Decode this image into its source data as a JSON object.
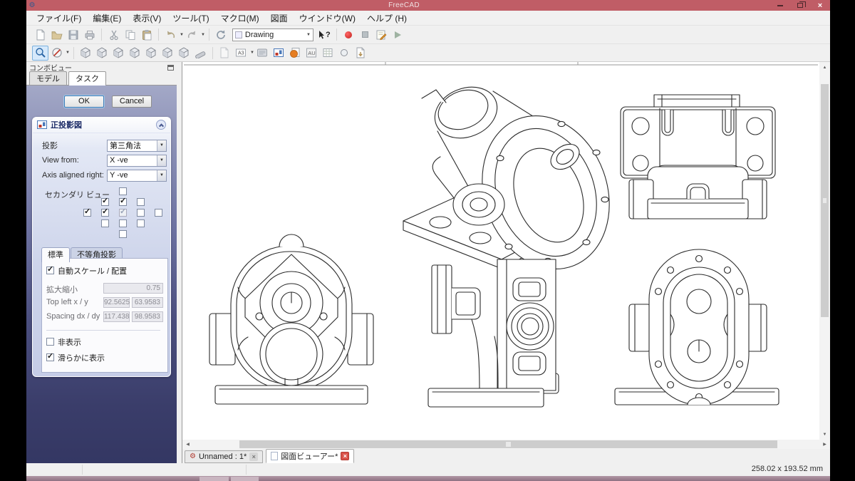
{
  "glyphs": {
    "close": "×",
    "gear": "⚙",
    "dropdown": "▼",
    "check": "✓",
    "scroll_up": "▲",
    "scroll_down": "▼",
    "scroll_left": "◀",
    "scroll_right": "▶",
    "whats_this": "?"
  },
  "window": {
    "title": "FreeCAD"
  },
  "menubar": {
    "items": [
      "ファイル(F)",
      "編集(E)",
      "表示(V)",
      "ツール(T)",
      "マクロ(M)",
      "図面",
      "ウインドウ(W)",
      "ヘルプ (H)"
    ]
  },
  "toolbars": {
    "workbench_value": "Drawing",
    "paper_size": "A3",
    "symbol_label": "AU"
  },
  "combo_view": {
    "title": "コンボビュー",
    "model_tab": "モデル",
    "task_tab": "タスク",
    "task": {
      "ok": "OK",
      "cancel": "Cancel",
      "section_title": "正投影図",
      "projection_label": "投影",
      "projection_value": "第三角法",
      "view_from_label": "View from:",
      "view_from_value": "X -ve",
      "axis_label": "Axis aligned right:",
      "axis_value": "Y -ve",
      "secondary_label": "セカンダリ ビュー",
      "secondary_grid": [
        [
          null,
          null,
          "off",
          null,
          null
        ],
        [
          null,
          "on",
          "on",
          "off",
          null
        ],
        [
          "on",
          "on",
          "on-dis",
          "off",
          "off"
        ],
        [
          null,
          "off",
          "off",
          "off",
          null
        ],
        [
          null,
          null,
          "off",
          null,
          null
        ]
      ],
      "standard_tab": "標準",
      "axonometric_tab": "不等角投影",
      "auto_scale_label": "自動スケール / 配置",
      "auto_scale_checked": true,
      "scale_label": "拡大縮小",
      "scale_value": "0.75",
      "topleft_label": "Top left x / y",
      "topleft_x": "92.5625",
      "topleft_y": "63.9583",
      "spacing_label": "Spacing dx / dy",
      "spacing_dx": "117.438",
      "spacing_dy": "98.9583",
      "hidden_label": "非表示",
      "hidden_checked": false,
      "smooth_label": "滑らかに表示",
      "smooth_checked": true
    }
  },
  "mdi": {
    "doc_tab": "Unnamed : 1*",
    "viewer_tab": "図面ビューアー*"
  },
  "statusbar": {
    "page_size": "258.02 x 193.52 mm"
  }
}
